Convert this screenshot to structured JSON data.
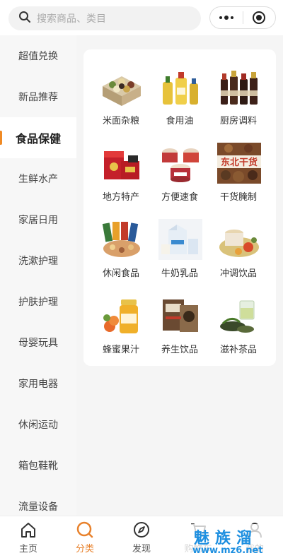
{
  "search": {
    "placeholder": "搜索商品、类目"
  },
  "sidebar": {
    "items": [
      {
        "label": "超值兑换",
        "active": false
      },
      {
        "label": "新品推荐",
        "active": false
      },
      {
        "label": "食品保健",
        "active": true
      },
      {
        "label": "生鲜水产",
        "active": false
      },
      {
        "label": "家居日用",
        "active": false
      },
      {
        "label": "洗漱护理",
        "active": false
      },
      {
        "label": "护肤护理",
        "active": false
      },
      {
        "label": "母婴玩具",
        "active": false
      },
      {
        "label": "家用电器",
        "active": false
      },
      {
        "label": "休闲运动",
        "active": false
      },
      {
        "label": "箱包鞋靴",
        "active": false
      },
      {
        "label": "流量设备",
        "active": false
      }
    ]
  },
  "categories": [
    {
      "label": "米面杂粮",
      "icon": "grain-image"
    },
    {
      "label": "食用油",
      "icon": "oil-image"
    },
    {
      "label": "厨房调料",
      "icon": "sauce-image"
    },
    {
      "label": "地方特产",
      "icon": "specialty-image"
    },
    {
      "label": "方便速食",
      "icon": "instant-food-image"
    },
    {
      "label": "干货腌制",
      "icon": "dried-food-image"
    },
    {
      "label": "休闲食品",
      "icon": "snacks-image"
    },
    {
      "label": "牛奶乳品",
      "icon": "milk-image"
    },
    {
      "label": "冲调饮品",
      "icon": "drink-image"
    },
    {
      "label": "蜂蜜果汁",
      "icon": "honey-image"
    },
    {
      "label": "养生饮品",
      "icon": "health-drink-image"
    },
    {
      "label": "滋补茶品",
      "icon": "tea-image"
    }
  ],
  "tabbar": {
    "items": [
      {
        "label": "主页",
        "icon": "home-icon",
        "active": false
      },
      {
        "label": "分类",
        "icon": "category-icon",
        "active": true
      },
      {
        "label": "发现",
        "icon": "compass-icon",
        "active": false
      },
      {
        "label": "购物车",
        "icon": "cart-icon",
        "active": false
      },
      {
        "label": "我的",
        "icon": "user-icon",
        "active": false
      }
    ]
  },
  "watermark": {
    "text": "魅族溜",
    "url": "www.mz6.net"
  },
  "colors": {
    "accent": "#e8812b",
    "indicator": "#f08a24",
    "watermark": "#1d8fe0"
  }
}
